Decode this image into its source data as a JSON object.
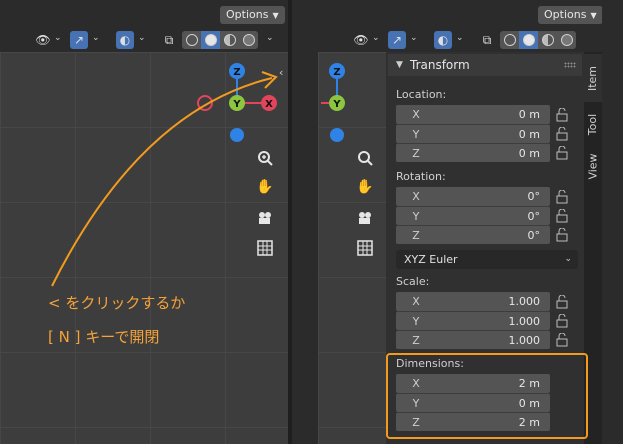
{
  "header": {
    "options_label": "Options"
  },
  "annotation": {
    "line1": "< をクリックするか",
    "line2": "[ N ] キーで開閉"
  },
  "gizmo": {
    "x": "X",
    "y": "Y",
    "z": "Z"
  },
  "npanel": {
    "transform_title": "Transform",
    "location": {
      "label": "Location:",
      "rows": [
        {
          "axis": "X",
          "value": "0 m"
        },
        {
          "axis": "Y",
          "value": "0 m"
        },
        {
          "axis": "Z",
          "value": "0 m"
        }
      ]
    },
    "rotation": {
      "label": "Rotation:",
      "rows": [
        {
          "axis": "X",
          "value": "0°"
        },
        {
          "axis": "Y",
          "value": "0°"
        },
        {
          "axis": "Z",
          "value": "0°"
        }
      ],
      "mode": "XYZ Euler"
    },
    "scale": {
      "label": "Scale:",
      "rows": [
        {
          "axis": "X",
          "value": "1.000"
        },
        {
          "axis": "Y",
          "value": "1.000"
        },
        {
          "axis": "Z",
          "value": "1.000"
        }
      ]
    },
    "dimensions": {
      "label": "Dimensions:",
      "rows": [
        {
          "axis": "X",
          "value": "2 m"
        },
        {
          "axis": "Y",
          "value": "0 m"
        },
        {
          "axis": "Z",
          "value": "2 m"
        }
      ]
    }
  },
  "side_tabs": [
    "Item",
    "Tool",
    "View"
  ],
  "colors": {
    "accent": "#4772b3",
    "highlight": "#f39b1f",
    "annotation": "#f4a23a",
    "axis_x": "#e2445c",
    "axis_y": "#8cc63f",
    "axis_z": "#2f83e6"
  }
}
